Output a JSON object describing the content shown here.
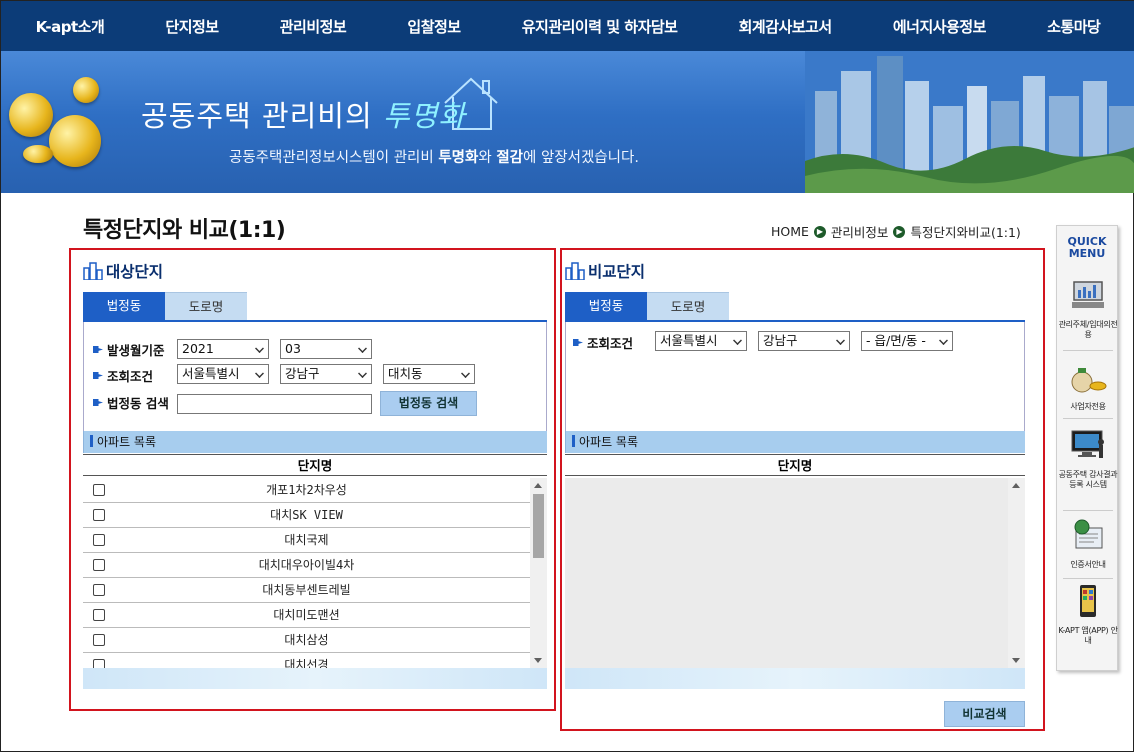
{
  "nav": {
    "items": [
      "K-apt소개",
      "단지정보",
      "관리비정보",
      "입찰정보",
      "유지관리이력 및 하자담보",
      "회계감사보고서",
      "에너지사용정보",
      "소통마당"
    ]
  },
  "banner": {
    "title_main": "공동주택 관리비의 ",
    "title_highlight": "투명화",
    "sub_prefix": "공동주택관리정보시스템이 관리비 ",
    "sub_bold1": "투명화",
    "sub_mid": "와 ",
    "sub_bold2": "절감",
    "sub_suffix": "에 앞장서겠습니다."
  },
  "page": {
    "title": "특정단지와 비교(1:1)",
    "breadcrumb": [
      "HOME",
      "관리비정보",
      "특정단지와비교(1:1)"
    ]
  },
  "left": {
    "heading": "대상단지",
    "tabs": [
      "법정동",
      "도로명"
    ],
    "period_label": "발생월기준",
    "year": "2021",
    "month": "03",
    "cond_label": "조회조건",
    "sido": "서울특별시",
    "gu": "강남구",
    "dong": "대치동",
    "search_label": "법정동 검색",
    "search_value": "",
    "search_button": "법정동 검색",
    "apt_list_title": "아파트 목록",
    "col_header": "단지명",
    "apartments": [
      "개포1차2차우성",
      "대치SK VIEW",
      "대치국제",
      "대치대우아이빌4차",
      "대치동부센트레빌",
      "대치미도맨션",
      "대치삼성",
      "대치선경"
    ]
  },
  "right": {
    "heading": "비교단지",
    "tabs": [
      "법정동",
      "도로명"
    ],
    "cond_label": "조회조건",
    "sido": "서울특별시",
    "gu": "강남구",
    "dong": "- 읍/면/동 -",
    "apt_list_title": "아파트 목록",
    "col_header": "단지명",
    "compare_button": "비교검색"
  },
  "quick": {
    "title_line1": "QUICK",
    "title_line2": "MENU",
    "items": [
      "관리주체/입대의전용",
      "사업자전용",
      "공동주택 감사결과 등록 시스템",
      "인증서안내",
      "K-APT 앱(APP) 안내"
    ]
  },
  "colors": {
    "nav_bg": "#0c3c78",
    "accent": "#1e5fc6",
    "highlight_box": "#d2141e",
    "list_bar": "#a7cdee"
  }
}
